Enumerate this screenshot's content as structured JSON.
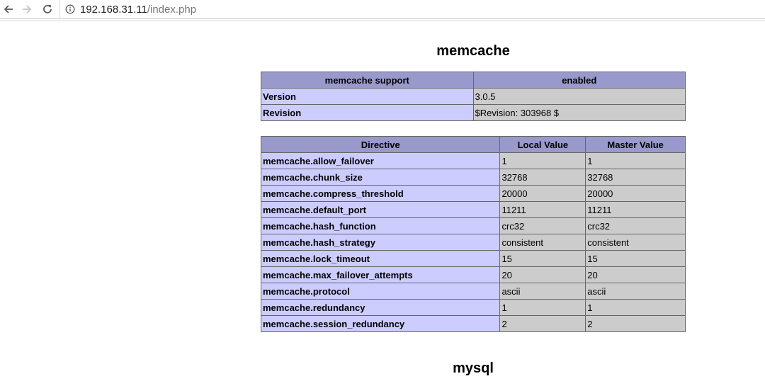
{
  "browser": {
    "url_host": "192.168.31.11",
    "url_path": "/index.php"
  },
  "memcache": {
    "title": "memcache",
    "support_table": {
      "header": [
        "memcache support",
        "enabled"
      ],
      "rows": [
        [
          "Version",
          "3.0.5"
        ],
        [
          "Revision",
          "$Revision: 303968 $"
        ]
      ]
    },
    "directives_table": {
      "header": [
        "Directive",
        "Local Value",
        "Master Value"
      ],
      "rows": [
        [
          "memcache.allow_failover",
          "1",
          "1"
        ],
        [
          "memcache.chunk_size",
          "32768",
          "32768"
        ],
        [
          "memcache.compress_threshold",
          "20000",
          "20000"
        ],
        [
          "memcache.default_port",
          "11211",
          "11211"
        ],
        [
          "memcache.hash_function",
          "crc32",
          "crc32"
        ],
        [
          "memcache.hash_strategy",
          "consistent",
          "consistent"
        ],
        [
          "memcache.lock_timeout",
          "15",
          "15"
        ],
        [
          "memcache.max_failover_attempts",
          "20",
          "20"
        ],
        [
          "memcache.protocol",
          "ascii",
          "ascii"
        ],
        [
          "memcache.redundancy",
          "1",
          "1"
        ],
        [
          "memcache.session_redundancy",
          "2",
          "2"
        ]
      ]
    }
  },
  "mysql": {
    "title": "mysql"
  },
  "colors": {
    "header_bg": "#9999cc",
    "key_bg": "#ccccff",
    "value_bg": "#cccccc",
    "border": "#666666"
  }
}
